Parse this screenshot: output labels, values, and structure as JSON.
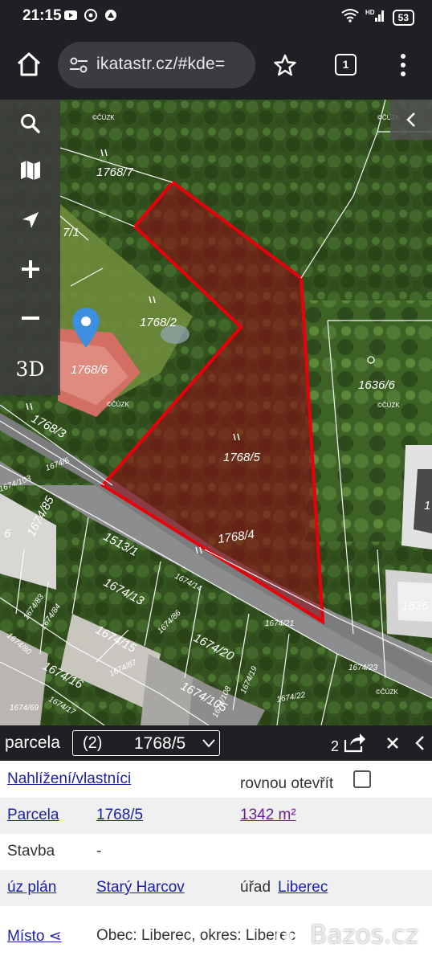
{
  "status_bar": {
    "time": "21:15",
    "battery": "53",
    "signal_text": "HD 5G"
  },
  "browser": {
    "url": "ikatastr.cz/#kde=",
    "tab_count": "1"
  },
  "map": {
    "toolbar": [
      "search-icon",
      "map-icon",
      "locate-icon",
      "zoom-in-icon",
      "zoom-out-icon"
    ],
    "toolbar_3d_label": "3D",
    "watermark": "©ČÚZK",
    "parcel_labels": [
      "1768/7",
      "7/1",
      "1768/2",
      "1768/6",
      "1768/3",
      "1768/5",
      "1768/4",
      "1636/6",
      "1674/5",
      "1513/1",
      "1674/85",
      "1674/13",
      "1674/14",
      "1674/86",
      "1674/15",
      "1674/87",
      "1674/20",
      "1674/21",
      "1674/23",
      "1674/105",
      "1674/19",
      "1674/22",
      "1674/108",
      "1674/16",
      "1674/83",
      "1674/84",
      "1674/80",
      "1674/17",
      "1674/103",
      "1674/82",
      "1674/69",
      "1636",
      "1",
      "6"
    ],
    "highlight_color": "#e8000a"
  },
  "panel": {
    "type_label": "parcela",
    "select_count": "(2)",
    "select_value": "1768/5",
    "result_count": "2",
    "rows": {
      "nahlizeni_link": "Nahlížení/vlastníci",
      "open_direct_label": "rovnou otevřít",
      "parcela_label": "Parcela",
      "parcela_value": "1768/5",
      "area_value": "1342 m²",
      "stavba_label": "Stavba",
      "stavba_value": "-",
      "uz_plan_label": "úz plán",
      "uz_plan_value": "Starý Harcov",
      "urad_label": "úřad",
      "urad_value": "Liberec",
      "misto_label": "Místo",
      "misto_value": "Obec: Liberec, okres: Liberec"
    }
  },
  "watermark_text": "Bazos.cz"
}
